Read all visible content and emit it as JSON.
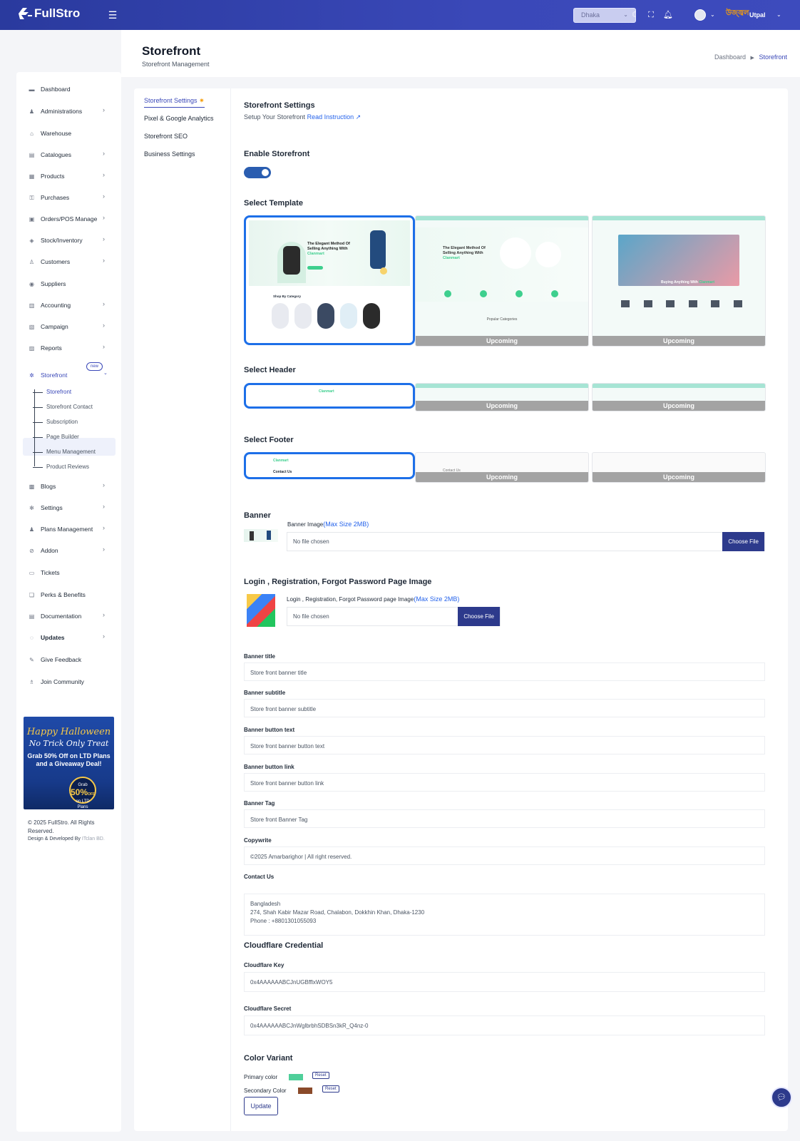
{
  "topbar": {
    "brand": "FullStro",
    "city_select": "Dhaka",
    "user_name": "Utpal",
    "flag_text": "উজ্জ্বল"
  },
  "sidebar": {
    "items": [
      {
        "label": "Dashboard",
        "icon": "monitor-icon",
        "arrow": false
      },
      {
        "label": "Administrations",
        "icon": "admin-icon",
        "arrow": true
      },
      {
        "label": "Warehouse",
        "icon": "warehouse-icon",
        "arrow": false
      },
      {
        "label": "Catalogues",
        "icon": "catalogue-icon",
        "arrow": true
      },
      {
        "label": "Products",
        "icon": "products-icon",
        "arrow": true
      },
      {
        "label": "Purchases",
        "icon": "purchases-icon",
        "arrow": true
      },
      {
        "label": "Orders/POS Manage",
        "icon": "orders-icon",
        "arrow": true
      },
      {
        "label": "Stock/Inventory",
        "icon": "stock-icon",
        "arrow": true
      },
      {
        "label": "Customers",
        "icon": "customers-icon",
        "arrow": true
      },
      {
        "label": "Suppliers",
        "icon": "suppliers-icon",
        "arrow": false
      },
      {
        "label": "Accounting",
        "icon": "accounting-icon",
        "arrow": true
      },
      {
        "label": "Campaign",
        "icon": "campaign-icon",
        "arrow": true
      },
      {
        "label": "Reports",
        "icon": "reports-icon",
        "arrow": true
      },
      {
        "label": "Storefront",
        "icon": "storefront-icon",
        "arrow": true,
        "badge": "new"
      },
      {
        "label": "Blogs",
        "icon": "blogs-icon",
        "arrow": true
      },
      {
        "label": "Settings",
        "icon": "settings-icon",
        "arrow": true
      },
      {
        "label": "Plans Management",
        "icon": "plans-icon",
        "arrow": true
      },
      {
        "label": "Addon",
        "icon": "addon-icon",
        "arrow": true
      },
      {
        "label": "Tickets",
        "icon": "tickets-icon",
        "arrow": false
      },
      {
        "label": "Perks & Benefits",
        "icon": "perks-icon",
        "arrow": false
      },
      {
        "label": "Documentation",
        "icon": "docs-icon",
        "arrow": true
      },
      {
        "label": "Updates",
        "icon": "updates-icon",
        "arrow": true
      },
      {
        "label": "Give Feedback",
        "icon": "feedback-icon",
        "arrow": false
      },
      {
        "label": "Join Community",
        "icon": "community-icon",
        "arrow": false
      }
    ],
    "storefront_sub": [
      "Storefront",
      "Storefront Contact",
      "Subscription",
      "Page Builder",
      "Menu Management",
      "Product Reviews"
    ],
    "promo": {
      "line1": "Happy Halloween",
      "line2": "No Trick Only Treat",
      "line3": "Grab 50% Off on LTD Plans and a Giveaway Deal!",
      "badge_top": "Grab",
      "badge_pct": "50%",
      "badge_off": "OFF",
      "badge_bottom": "on LTD Plans"
    },
    "copyright": "© 2025 FullStro. All Rights Reserved.",
    "developer_prefix": "Design & Developed By",
    "developer_name": "ITclan BD."
  },
  "page": {
    "title": "Storefront",
    "subtitle": "Storefront Management",
    "breadcrumb": [
      "Dashboard",
      "Storefront"
    ]
  },
  "tabs": [
    "Storefront Settings",
    "Pixel & Google Analytics",
    "Storefront SEO",
    "Business Settings"
  ],
  "settings": {
    "title": "Storefront Settings",
    "subtitle": "Setup Your Storefront",
    "read_link": "Read Instruction",
    "enable_title": "Enable Storefront",
    "enabled": true,
    "template_title": "Select Template",
    "header_title": "Select Header",
    "footer_title": "Select Footer",
    "upcoming": "Upcoming",
    "template_headline": "The Elegant Method Of Selling Anything With",
    "template_brand": "Clanmart",
    "template_shop_cat": "Shop By Category",
    "template_popular": "Popular Categories",
    "template_buying": "Buying Anything With",
    "footer_contact": "Contact Us"
  },
  "banner": {
    "title": "Banner",
    "image_label": "Banner Image",
    "max_size": "(Max Size 2MB)",
    "no_file": "No file chosen",
    "choose": "Choose File"
  },
  "login_image": {
    "title": "Login , Registration, Forgot Password Page Image",
    "label": "Login , Registration, Forgot Password page Image",
    "max_size": "(Max Size 2MB)",
    "no_file": "No file chosen",
    "choose": "Choose File"
  },
  "fields": [
    {
      "label": "Banner title",
      "value": "Store front banner title"
    },
    {
      "label": "Banner subtitle",
      "value": "Store front banner subtitle"
    },
    {
      "label": "Banner button text",
      "value": "Store front banner button text"
    },
    {
      "label": "Banner button link",
      "value": "Store front banner button link"
    },
    {
      "label": "Banner Tag",
      "value": "Store front Banner Tag"
    },
    {
      "label": "Copywrite",
      "value": "©2025 Amarbarighor | All right reserved."
    }
  ],
  "contact": {
    "label": "Contact Us",
    "line1": "Bangladesh",
    "line2": "274, Shah Kabir Mazar Road, Chalabon, Dokkhin Khan, Dhaka-1230",
    "line3": "Phone : +8801301055093"
  },
  "cloudflare": {
    "title": "Cloudflare Credential",
    "key_label": "Cloudflare Key",
    "key_value": "0x4AAAAAABCJnUGBfflxWOY5",
    "secret_label": "Cloudflare Secret",
    "secret_value": "0x4AAAAAABCJnWglbrbhSDBSn3kR_Q4nz-0"
  },
  "colors": {
    "title": "Color Variant",
    "primary_label": "Primary color",
    "primary": "#4fcf9a",
    "secondary_label": "Secondary Color",
    "secondary": "#8a4a2a",
    "reset": "Reset",
    "update": "Update"
  }
}
